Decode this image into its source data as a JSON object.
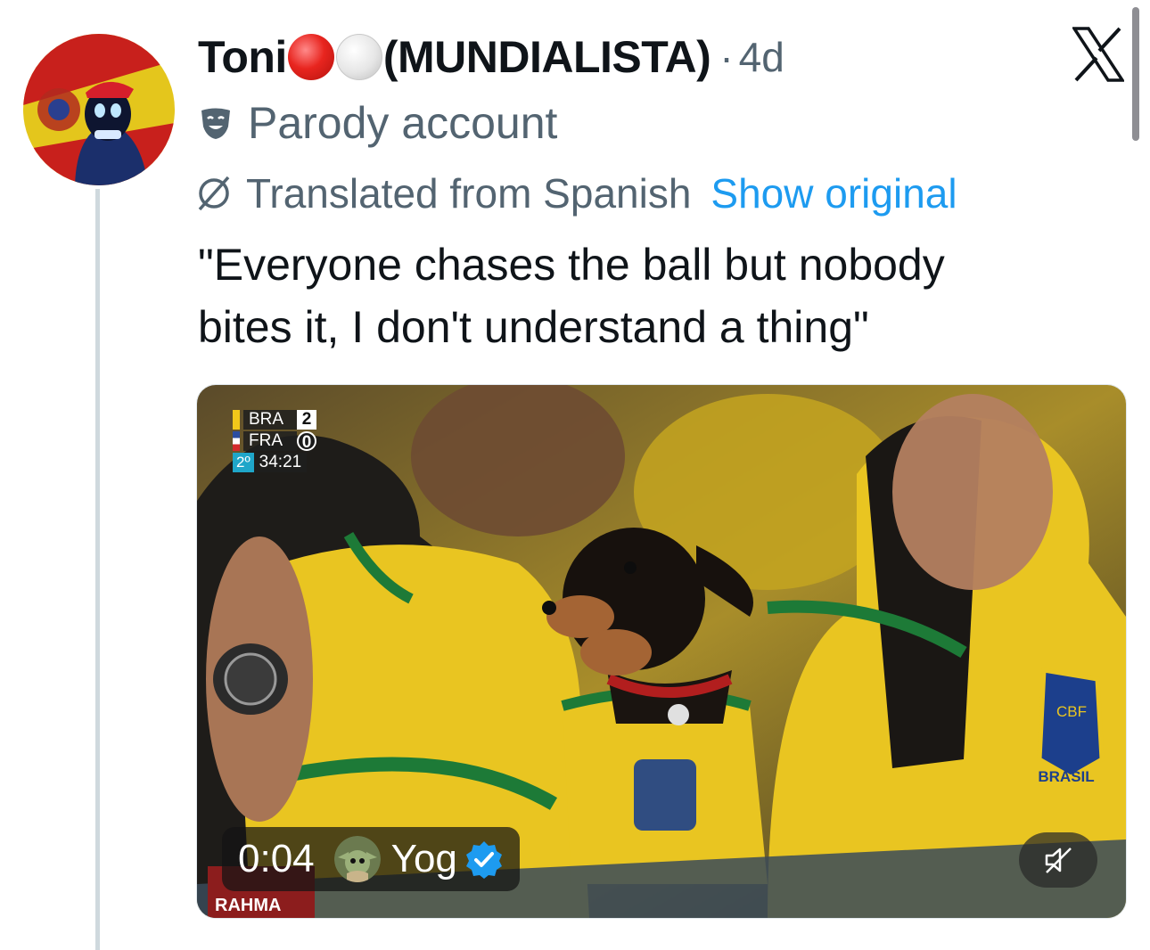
{
  "author": {
    "display_name": "Toni",
    "display_name_suffix": "(MUNDIALISTA)",
    "separator": "·",
    "timestamp": "4d",
    "label_text": "Parody account",
    "avatar_icon": "masked-fan-avatar"
  },
  "translation": {
    "label": "Translated from Spanish",
    "show_original": "Show original"
  },
  "tweet": {
    "text_line1": "\"Everyone chases the ball but nobody",
    "text_line2": "bites it, I don't understand a thing\""
  },
  "media": {
    "scoreboard": {
      "team1": "BRA",
      "score1": "2",
      "team2": "FRA",
      "score2": "0",
      "period": "2º",
      "clock": "34:21"
    },
    "video_time": "0:04",
    "uploader_name": "Yog",
    "uploader_verified": true,
    "jersey_text": "BRASIL",
    "crest_text": "CBF",
    "cup_text": "RAHMA",
    "mute_icon": "speaker-muted-icon"
  },
  "colors": {
    "accent": "#1d9bf0",
    "muted_text": "#536471",
    "primary_text": "#0f1419",
    "jersey_yellow": "#f0cc1a",
    "jersey_green": "#1f8a3c"
  }
}
